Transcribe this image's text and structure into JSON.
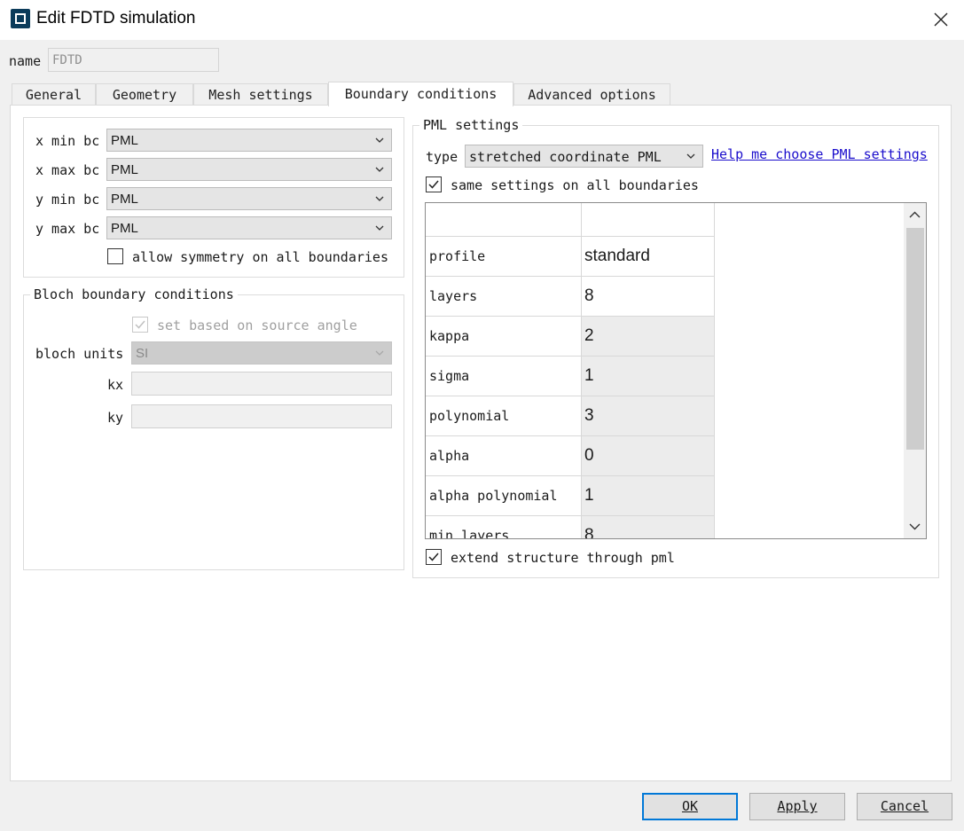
{
  "window": {
    "title": "Edit FDTD simulation"
  },
  "name_label": "name",
  "name_value": "FDTD",
  "tabs": [
    {
      "label": "General"
    },
    {
      "label": "Geometry"
    },
    {
      "label": "Mesh settings"
    },
    {
      "label": "Boundary conditions",
      "active": true
    },
    {
      "label": "Advanced options"
    }
  ],
  "bc": {
    "x_min_label": "x min bc",
    "x_min_value": "PML",
    "x_max_label": "x max bc",
    "x_max_value": "PML",
    "y_min_label": "y min bc",
    "y_min_value": "PML",
    "y_max_label": "y max bc",
    "y_max_value": "PML",
    "allow_symmetry_label": "allow symmetry on all boundaries",
    "allow_symmetry_checked": false
  },
  "bloch": {
    "title": "Bloch boundary conditions",
    "set_based_label": "set based on source angle",
    "set_based_checked": true,
    "units_label": "bloch units",
    "units_value": "SI",
    "kx_label": "kx",
    "ky_label": "ky"
  },
  "pml": {
    "title": "PML settings",
    "type_label": "type",
    "type_value": "stretched coordinate PML",
    "help_link": "Help me choose PML settings",
    "same_settings_label": "same settings on all boundaries",
    "same_settings_checked": true,
    "rows": [
      {
        "name": "profile",
        "value": "standard"
      },
      {
        "name": "layers",
        "value": "8"
      },
      {
        "name": "kappa",
        "value": "2"
      },
      {
        "name": "sigma",
        "value": "1"
      },
      {
        "name": "polynomial",
        "value": "3"
      },
      {
        "name": "alpha",
        "value": "0"
      },
      {
        "name": "alpha polynomial",
        "value": "1"
      },
      {
        "name": "min layers",
        "value": "8"
      }
    ],
    "extend_label": "extend structure through pml",
    "extend_checked": true
  },
  "buttons": {
    "ok_label": "OK",
    "apply_label": "Apply",
    "cancel_label": "Cancel"
  },
  "colors": {
    "link": "#1a0dcc",
    "default_button_border": "#0078d7"
  }
}
